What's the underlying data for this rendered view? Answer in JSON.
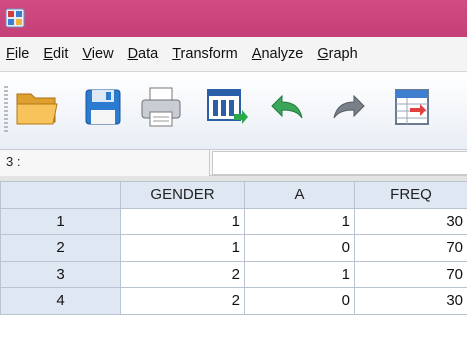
{
  "menu": {
    "items": [
      {
        "pre": "",
        "ul": "F",
        "post": "ile"
      },
      {
        "pre": "",
        "ul": "E",
        "post": "dit"
      },
      {
        "pre": "",
        "ul": "V",
        "post": "iew"
      },
      {
        "pre": "",
        "ul": "D",
        "post": "ata"
      },
      {
        "pre": "",
        "ul": "T",
        "post": "ransform"
      },
      {
        "pre": "",
        "ul": "A",
        "post": "nalyze"
      },
      {
        "pre": "",
        "ul": "G",
        "post": "raph"
      }
    ]
  },
  "toolbar": {
    "icons": [
      "open-folder-icon",
      "save-icon",
      "print-icon",
      "recall-dialog-icon",
      "undo-icon",
      "redo-icon",
      "goto-case-icon"
    ]
  },
  "cellbar": {
    "ref": "3 :",
    "value": ""
  },
  "grid": {
    "columns": [
      "GENDER",
      "A",
      "FREQ"
    ],
    "rows": [
      {
        "num": "1",
        "cells": [
          "1",
          "1",
          "30"
        ]
      },
      {
        "num": "2",
        "cells": [
          "1",
          "0",
          "70"
        ]
      },
      {
        "num": "3",
        "cells": [
          "2",
          "1",
          "70"
        ]
      },
      {
        "num": "4",
        "cells": [
          "2",
          "0",
          "30"
        ]
      }
    ]
  },
  "colors": {
    "titlebar": "#c94479",
    "header": "#dfe7f3",
    "gridline": "#b8c4d4"
  }
}
